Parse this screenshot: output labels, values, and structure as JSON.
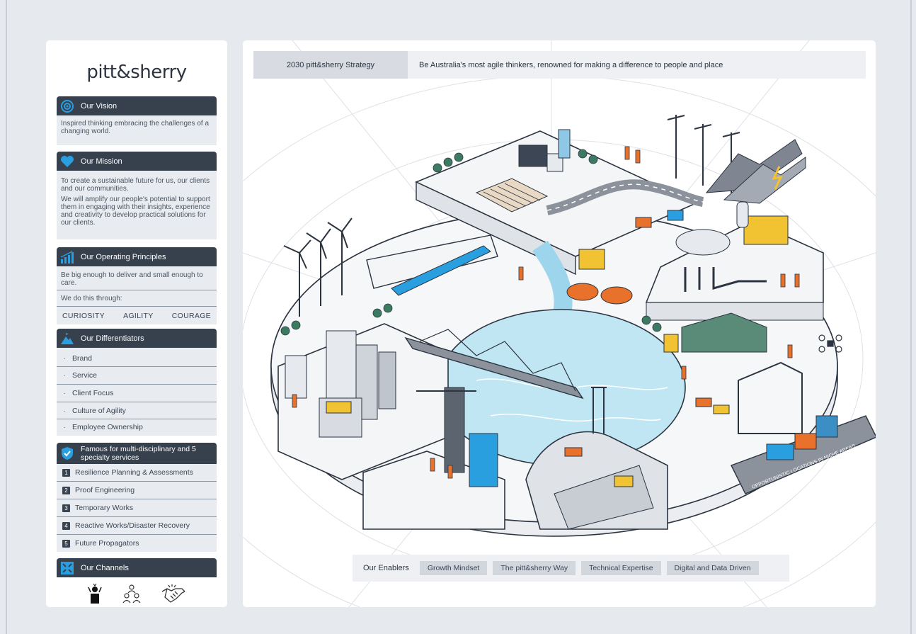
{
  "logo": "pitt&sherry",
  "vision": {
    "title": "Our Vision",
    "text": "Inspired thinking embracing the challenges of a changing world."
  },
  "mission": {
    "title": "Our Mission",
    "text1": "To create a sustainable future for us, our clients and our communities.",
    "text2": "We will amplify our people's potential to support them in engaging with their insights, experience and creativity to develop practical solutions for our clients."
  },
  "principles": {
    "title": "Our Operating Principles",
    "text1": "Be big enough to deliver and small enough to care.",
    "text2": "We do this through:",
    "values": [
      "CURIOSITY",
      "AGILITY",
      "COURAGE"
    ]
  },
  "differentiators": {
    "title": "Our Differentiators",
    "items": [
      "Brand",
      "Service",
      "Client Focus",
      "Culture of Agility",
      "Employee Ownership"
    ]
  },
  "services": {
    "title": "Famous for multi-disciplinary and 5 specialty services",
    "items": [
      {
        "num": "1",
        "label": "Resilience Planning & Assessments"
      },
      {
        "num": "2",
        "label": "Proof Engineering"
      },
      {
        "num": "3",
        "label": "Temporary Works"
      },
      {
        "num": "4",
        "label": "Reactive Works/Disaster Recovery"
      },
      {
        "num": "5",
        "label": "Future Propagators"
      }
    ]
  },
  "channels": {
    "title": "Our Channels",
    "icons": [
      "person-speaker-icon",
      "people-group-icon",
      "handshake-icon"
    ]
  },
  "strategy": {
    "label": "2030 pitt&sherry Strategy",
    "statement": "Be Australia's most agile thinkers, renowned for making a difference to people and place"
  },
  "ship_banner": "OPPORTUNISTIC LOCATIONS IN NICHE AREAS",
  "enablers": {
    "title": "Our Enablers",
    "items": [
      "Growth Mindset",
      "The pitt&sherry Way",
      "Technical Expertise",
      "Digital and Data Driven"
    ]
  },
  "colors": {
    "header": "#37404d",
    "accent_blue": "#2a9fe0",
    "panel_bg": "#e8ebef",
    "water": "#bfe6f2",
    "yellow": "#f1c232",
    "orange": "#e8722c"
  }
}
